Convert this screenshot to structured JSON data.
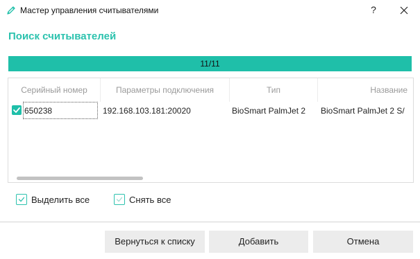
{
  "window": {
    "title": "Мастер управления считывателями",
    "help_label": "?"
  },
  "section_title": "Поиск считывателей",
  "progress": {
    "text": "11/11",
    "fraction": 1.0,
    "color": "#1fbfa9"
  },
  "table": {
    "columns": [
      "Серийный номер",
      "Параметры подключения",
      "Тип",
      "Название"
    ],
    "rows": [
      {
        "checked": true,
        "serial": "650238",
        "connection": "192.168.103.181:20020",
        "type": "BioSmart PalmJet 2",
        "name": "BioSmart PalmJet 2 S/"
      }
    ]
  },
  "select_all": {
    "label": "Выделить все",
    "checked": false
  },
  "deselect_all": {
    "label": "Снять все",
    "checked": false
  },
  "buttons": {
    "back": "Вернуться к списку",
    "add": "Добавить",
    "cancel": "Отмена"
  },
  "colors": {
    "accent": "#2cc2ae",
    "button_bg": "#ececec"
  },
  "icons": {
    "app": "pencil-icon",
    "close": "close-icon",
    "check": "checkmark-icon"
  }
}
